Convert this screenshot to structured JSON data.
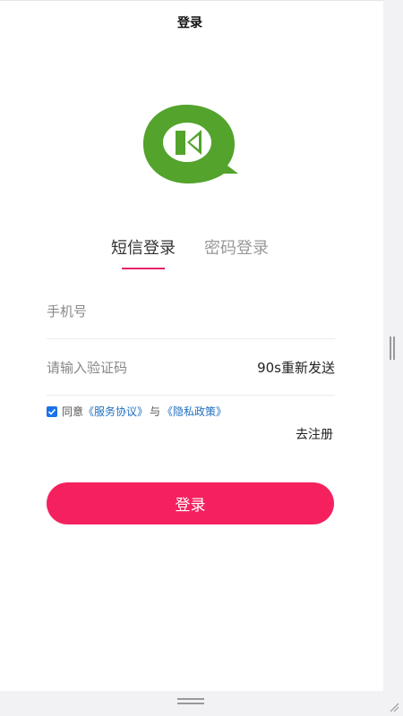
{
  "header": {
    "title": "登录"
  },
  "logo": {
    "icon": "app-logo-icon",
    "color": "#53a32c"
  },
  "tabs": [
    {
      "label": "短信登录",
      "active": true
    },
    {
      "label": "密码登录",
      "active": false
    }
  ],
  "form": {
    "phone_placeholder": "手机号",
    "phone_value": "",
    "code_placeholder": "请输入验证码",
    "code_value": "",
    "resend_label": "90s重新发送"
  },
  "agreement": {
    "checked": true,
    "prefix": "同意",
    "service_link": "《服务协议》",
    "conjunction": "与",
    "privacy_link": "《隐私政策》"
  },
  "register_link": "去注册",
  "login_button": "登录",
  "colors": {
    "accent": "#f5215f",
    "link": "#1f6fc1",
    "logo_green": "#53a32c",
    "checkbox": "#1a73e8"
  }
}
